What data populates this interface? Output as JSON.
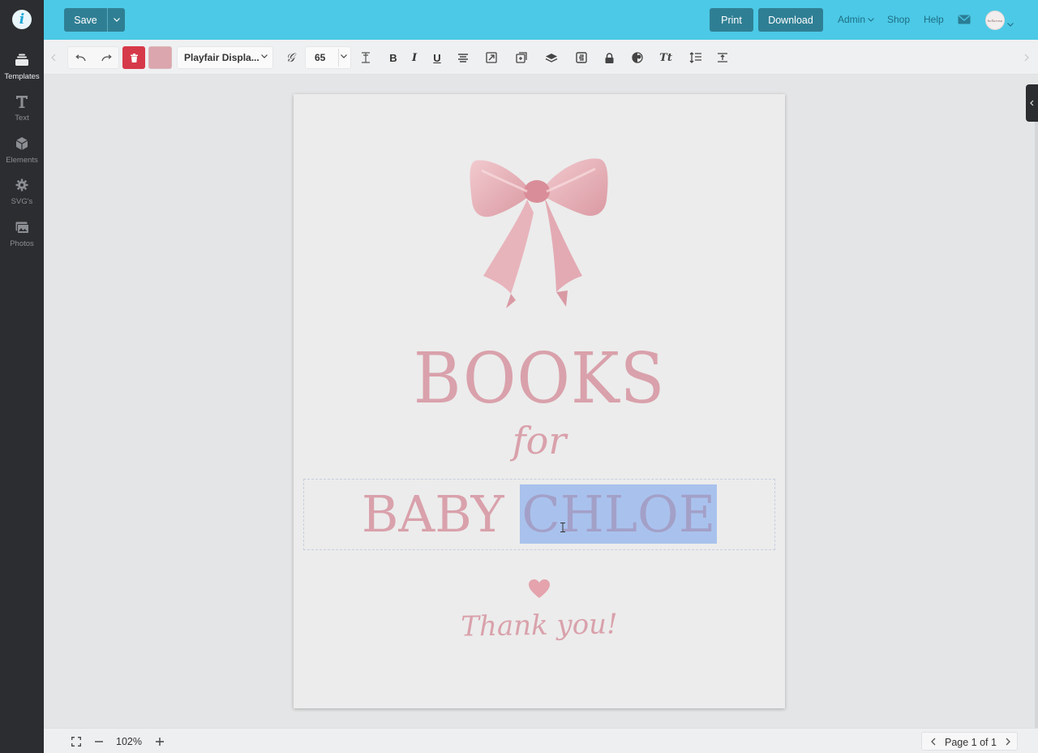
{
  "sidebar": {
    "items": [
      {
        "label": "Templates",
        "icon": "templates-icon"
      },
      {
        "label": "Text",
        "icon": "text-icon"
      },
      {
        "label": "Elements",
        "icon": "elements-icon"
      },
      {
        "label": "SVG's",
        "icon": "svgs-icon"
      },
      {
        "label": "Photos",
        "icon": "photos-icon"
      }
    ],
    "logo_letter": "i"
  },
  "topbar": {
    "save_label": "Save",
    "print_label": "Print",
    "download_label": "Download",
    "admin_label": "Admin",
    "shop_label": "Shop",
    "help_label": "Help",
    "avatar_text": "bellarosa",
    "accent_color": "#4cc9e6",
    "button_color": "#2f7f94"
  },
  "toolbar": {
    "font_name": "Playfair Displa...",
    "font_size": "65",
    "text_color": "#dba6ad",
    "delete_color": "#d6394a"
  },
  "canvas": {
    "line1": "BOOKS",
    "line2": "for",
    "line3_plain": "BABY",
    "line3_selected": "CHLOE",
    "line4": "Thank you!",
    "text_color": "#d9a1ab",
    "selection_color": "#a9c2ed"
  },
  "bottombar": {
    "zoom_label": "102%",
    "page_label": "Page 1 of 1"
  }
}
